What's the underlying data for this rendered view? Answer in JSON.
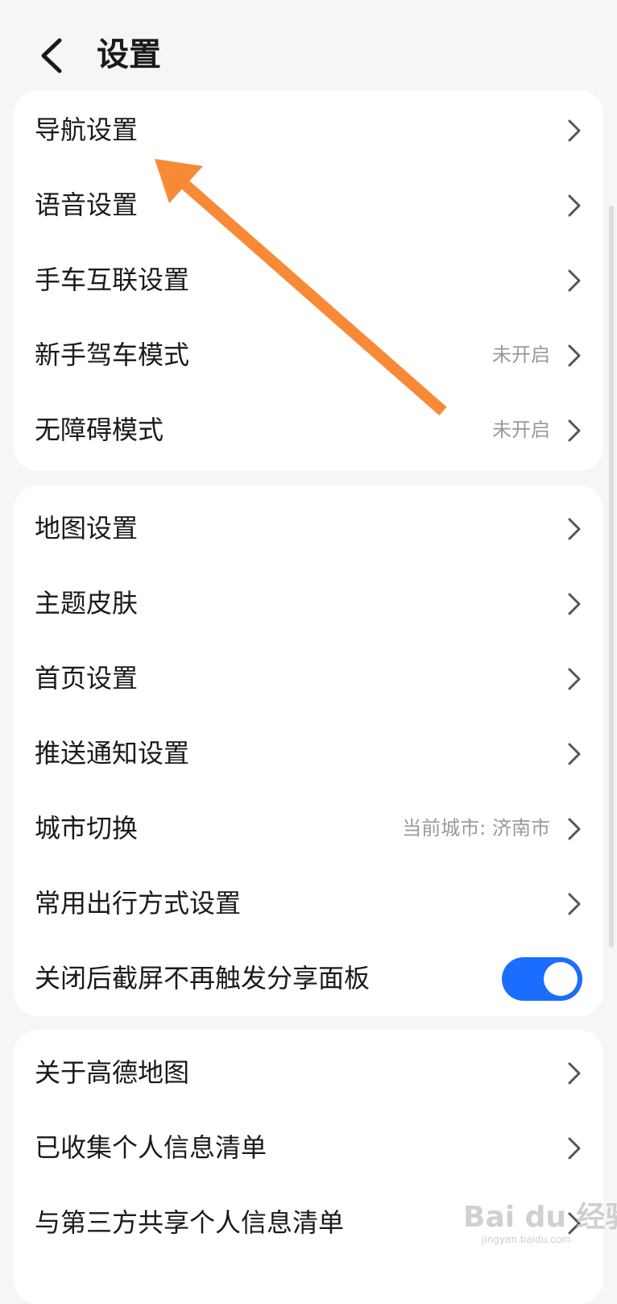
{
  "header": {
    "title": "设置",
    "back_icon": "chevron-left-icon"
  },
  "group1": {
    "items": [
      {
        "label": "导航设置",
        "value": ""
      },
      {
        "label": "语音设置",
        "value": ""
      },
      {
        "label": "手车互联设置",
        "value": ""
      },
      {
        "label": "新手驾车模式",
        "value": "未开启"
      },
      {
        "label": "无障碍模式",
        "value": "未开启"
      }
    ]
  },
  "group2": {
    "items": [
      {
        "label": "地图设置",
        "value": ""
      },
      {
        "label": "主题皮肤",
        "value": ""
      },
      {
        "label": "首页设置",
        "value": ""
      },
      {
        "label": "推送通知设置",
        "value": ""
      },
      {
        "label": "城市切换",
        "value": "当前城市: 济南市"
      },
      {
        "label": "常用出行方式设置",
        "value": ""
      },
      {
        "label": "关闭后截屏不再触发分享面板",
        "toggle_on": true
      }
    ]
  },
  "group3": {
    "items": [
      {
        "label": "关于高德地图",
        "value": ""
      },
      {
        "label": "已收集个人信息清单",
        "value": ""
      },
      {
        "label": "与第三方共享个人信息清单",
        "value": ""
      }
    ]
  },
  "watermark": {
    "text": "Bai du 经验",
    "sub": "jingyan.baidu.com"
  },
  "colors": {
    "accent": "#1a6dff",
    "annotation_arrow": "#f88a37",
    "background": "#f5f6f8"
  }
}
